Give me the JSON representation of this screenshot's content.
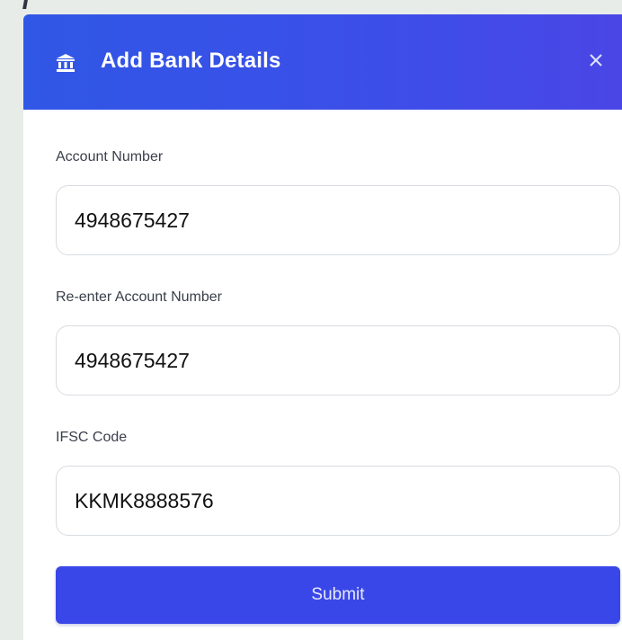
{
  "modal": {
    "title": "Add Bank Details",
    "close_symbol": "×",
    "icon": "bank-icon"
  },
  "form": {
    "account_number": {
      "label": "Account Number",
      "value": "4948675427"
    },
    "reenter_account_number": {
      "label": "Re-enter Account Number",
      "value": "4948675427"
    },
    "ifsc_code": {
      "label": "IFSC Code",
      "value": "KKMK8888576"
    },
    "submit_label": "Submit"
  },
  "colors": {
    "header_start": "#3057e6",
    "header_end": "#4a46e6",
    "submit_button": "#3a47e8",
    "background": "#e7ece9"
  }
}
